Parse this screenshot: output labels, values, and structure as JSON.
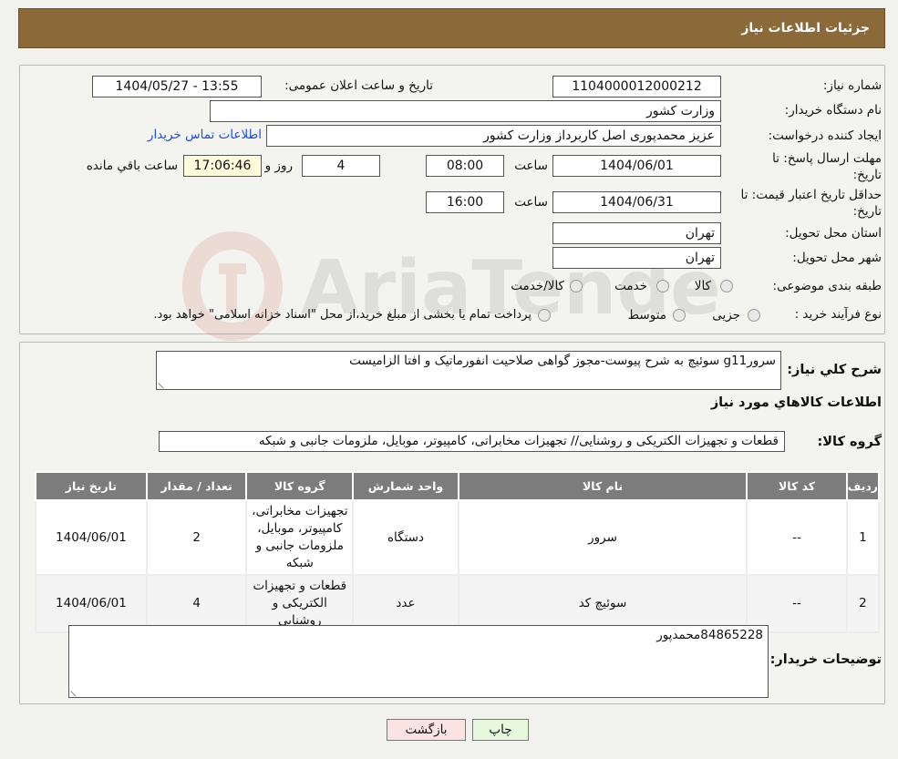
{
  "header": {
    "title": "جزئیات اطلاعات نیاز"
  },
  "form": {
    "need_number_label": "شماره نیاز:",
    "need_number": "1104000012000212",
    "announce_label": "تاریخ و ساعت اعلان عمومی:",
    "announce_value": "1404/05/27 - 13:55",
    "buyer_label": "نام دستگاه خریدار:",
    "buyer_value": "وزارت کشور",
    "creator_label": "ایجاد کننده درخواست:",
    "creator_value": "عزیز محمدپوری اصل کاربرداز وزارت کشور",
    "contact_link": "اطلاعات تماس خریدار",
    "deadline_label_1": "مهلت ارسال پاسخ: تا",
    "deadline_label_2": "تاریخ:",
    "deadline_date": "1404/06/01",
    "time_word": "ساعت",
    "deadline_time": "08:00",
    "days_value": "4",
    "days_word": "روز و",
    "remaining_time": "17:06:46",
    "remaining_word": "ساعت باقي مانده",
    "validity_label_1": "حداقل تاریخ اعتبار قیمت: تا",
    "validity_label_2": "تاریخ:",
    "validity_date": "1404/06/31",
    "validity_time": "16:00",
    "province_label": "استان محل تحویل:",
    "province_value": "تهران",
    "city_label": "شهر محل تحویل:",
    "city_value": "تهران",
    "category_label": "طبقه بندی موضوعی:",
    "category_options": [
      "کالا",
      "خدمت",
      "کالا/خدمت"
    ],
    "process_label": "نوع فرآیند خرید :",
    "process_options": [
      "جزیی",
      "متوسط"
    ],
    "process_note": "پرداخت تمام یا بخشی از مبلغ خرید،از محل \"اسناد خزانه اسلامی\" خواهد بود."
  },
  "description": {
    "label": "شرح کلي نياز:",
    "value": "سرورg11 سوئیچ به شرح پیوست-مجوز گواهی صلاحیت انفورماتیک و افتا الزامیست"
  },
  "goods": {
    "section_title": "اطلاعات کالاهاي مورد نياز",
    "group_label": "گروه کالا:",
    "group_value": "قطعات و تجهیزات الکتریکی و روشنایی// تجهیزات مخابراتی، کامپیوتر، موبایل، ملزومات جانبی و شبکه",
    "columns": [
      "ردیف",
      "کد کالا",
      "نام کالا",
      "واحد شمارش",
      "گروه کالا",
      "تعداد / مقدار",
      "تاریخ نیاز"
    ],
    "rows": [
      [
        "1",
        "--",
        "سرور",
        "دستگاه",
        "تجهیزات مخابراتی، کامپیوتر، موبایل، ملزومات جانبی و شبکه",
        "2",
        "1404/06/01"
      ],
      [
        "2",
        "--",
        "سوئیچ کد",
        "عدد",
        "قطعات و تجهیزات الکتریکی و روشنایی",
        "4",
        "1404/06/01"
      ]
    ]
  },
  "buyer_notes": {
    "label": "توضیحات خریدار:",
    "value": "84865228محمدپور"
  },
  "buttons": {
    "print": "چاپ",
    "back": "بازگشت"
  },
  "watermark_text": "AriaTender.neT"
}
